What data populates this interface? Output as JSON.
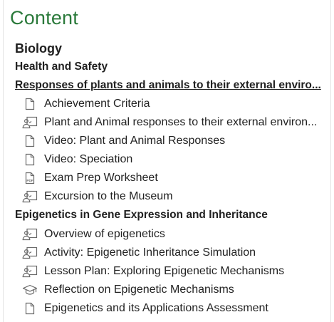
{
  "content": {
    "title": "Content",
    "course": "Biology",
    "modules": [
      {
        "title": "Health and Safety"
      },
      {
        "title": "Responses of plants and animals to their external enviro...",
        "items": [
          {
            "label": "Achievement Criteria",
            "icon": "document-icon"
          },
          {
            "label": "Plant and Animal responses to their external environ...",
            "icon": "lesson-icon"
          },
          {
            "label": "Video: Plant and Animal Responses",
            "icon": "document-icon"
          },
          {
            "label": "Video: Speciation",
            "icon": "document-icon"
          },
          {
            "label": "Exam Prep Worksheet",
            "icon": "pdf-icon",
            "icon_text": "PDF"
          },
          {
            "label": "Excursion to the Museum",
            "icon": "lesson-icon"
          }
        ]
      },
      {
        "title": "Epigenetics in Gene Expression and Inheritance",
        "items": [
          {
            "label": "Overview of epigenetics",
            "icon": "lesson-icon"
          },
          {
            "label": "Activity: Epigenetic Inheritance Simulation",
            "icon": "lesson-icon"
          },
          {
            "label": "Lesson Plan: Exploring Epigenetic Mechanisms",
            "icon": "lesson-icon"
          },
          {
            "label": "Reflection on Epigenetic Mechanisms",
            "icon": "graduation-cap-icon"
          },
          {
            "label": "Epigenetics and its Applications Assessment",
            "icon": "document-icon"
          }
        ]
      }
    ]
  },
  "colors": {
    "title": "#2b7a3b",
    "icon_stroke": "#6a6a6a"
  }
}
